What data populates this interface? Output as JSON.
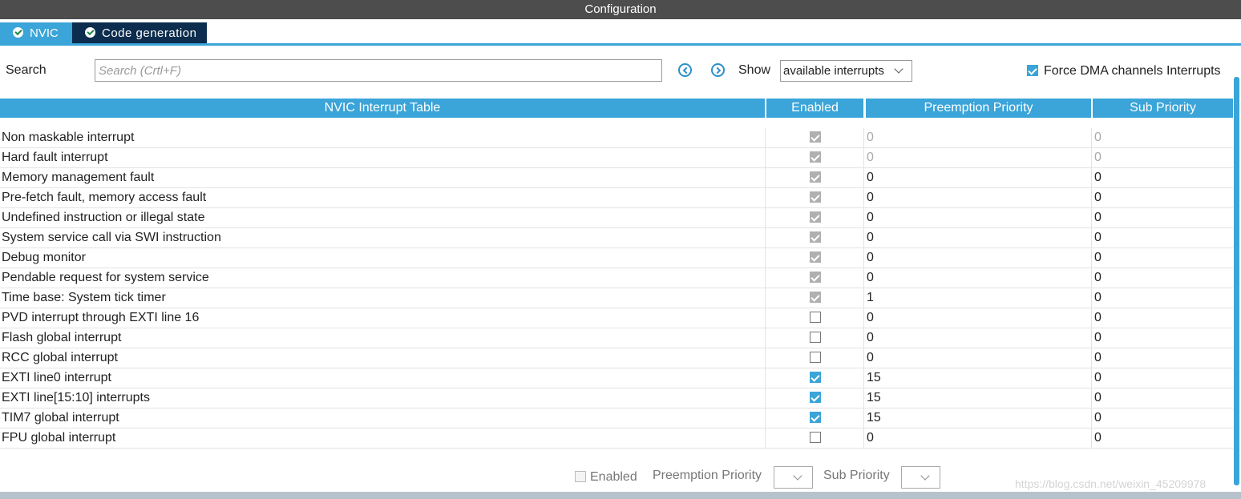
{
  "window": {
    "title": "Configuration"
  },
  "tabs": [
    {
      "label": "NVIC",
      "icon": "check-circle-icon"
    },
    {
      "label": "Code generation",
      "icon": "check-circle-icon"
    }
  ],
  "toolbar": {
    "search_label": "Search",
    "search_placeholder": "Search (Crtl+F)",
    "prev_icon": "chevron-left-circle-icon",
    "next_icon": "chevron-right-circle-icon",
    "show_label": "Show",
    "show_value": "available interrupts",
    "force_dma_label": "Force DMA channels Interrupts",
    "force_dma_checked": true
  },
  "table": {
    "headers": [
      "NVIC Interrupt Table",
      "Enabled",
      "Preemption Priority",
      "Sub Priority"
    ],
    "rows": [
      {
        "name": "Non maskable interrupt",
        "enabled": true,
        "locked": true,
        "preemption": "0",
        "sub": "0",
        "dim": true
      },
      {
        "name": "Hard fault interrupt",
        "enabled": true,
        "locked": true,
        "preemption": "0",
        "sub": "0",
        "dim": true
      },
      {
        "name": "Memory management fault",
        "enabled": true,
        "locked": true,
        "preemption": "0",
        "sub": "0",
        "dim": false
      },
      {
        "name": "Pre-fetch fault, memory access fault",
        "enabled": true,
        "locked": true,
        "preemption": "0",
        "sub": "0",
        "dim": false
      },
      {
        "name": "Undefined instruction or illegal state",
        "enabled": true,
        "locked": true,
        "preemption": "0",
        "sub": "0",
        "dim": false
      },
      {
        "name": "System service call via SWI instruction",
        "enabled": true,
        "locked": true,
        "preemption": "0",
        "sub": "0",
        "dim": false
      },
      {
        "name": "Debug monitor",
        "enabled": true,
        "locked": true,
        "preemption": "0",
        "sub": "0",
        "dim": false
      },
      {
        "name": "Pendable request for system service",
        "enabled": true,
        "locked": true,
        "preemption": "0",
        "sub": "0",
        "dim": false
      },
      {
        "name": "Time base: System tick timer",
        "enabled": true,
        "locked": true,
        "preemption": "1",
        "sub": "0",
        "dim": false
      },
      {
        "name": "PVD interrupt through EXTI line 16",
        "enabled": false,
        "locked": false,
        "preemption": "0",
        "sub": "0",
        "dim": false
      },
      {
        "name": "Flash global interrupt",
        "enabled": false,
        "locked": false,
        "preemption": "0",
        "sub": "0",
        "dim": false
      },
      {
        "name": "RCC global interrupt",
        "enabled": false,
        "locked": false,
        "preemption": "0",
        "sub": "0",
        "dim": false
      },
      {
        "name": "EXTI line0 interrupt",
        "enabled": true,
        "locked": false,
        "preemption": "15",
        "sub": "0",
        "dim": false
      },
      {
        "name": "EXTI line[15:10] interrupts",
        "enabled": true,
        "locked": false,
        "preemption": "15",
        "sub": "0",
        "dim": false
      },
      {
        "name": "TIM7 global interrupt",
        "enabled": true,
        "locked": false,
        "preemption": "15",
        "sub": "0",
        "dim": false
      },
      {
        "name": "FPU global interrupt",
        "enabled": false,
        "locked": false,
        "preemption": "0",
        "sub": "0",
        "dim": false
      }
    ]
  },
  "bottom_bar": {
    "enabled_label": "Enabled",
    "preemption_label": "Preemption Priority",
    "sub_label": "Sub Priority"
  },
  "watermark": "https://blog.csdn.net/weixin_45209978",
  "colors": {
    "accent": "#3ba4d8",
    "title_bar": "#4d4d4d",
    "active_tab": "#0c2d4d"
  }
}
